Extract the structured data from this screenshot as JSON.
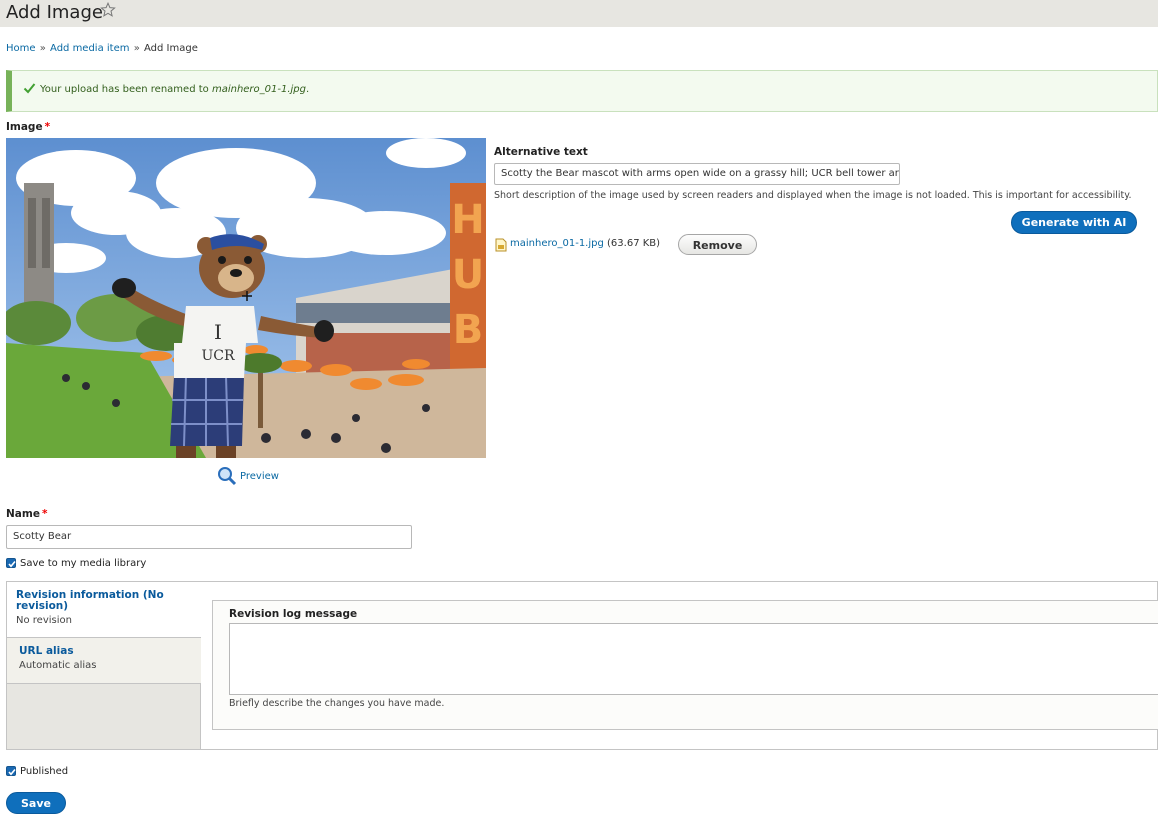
{
  "header": {
    "title": "Add Image",
    "star_icon": "star-outline-icon"
  },
  "breadcrumb": {
    "home": "Home",
    "separator": "»",
    "add_media": "Add media item",
    "current": "Add Image"
  },
  "message": {
    "icon": "check-icon",
    "prefix": "Your upload has been renamed to",
    "filename": "mainhero_01-1.jpg",
    "suffix": "."
  },
  "image_field": {
    "label": "Image",
    "required_mark": "*",
    "preview_link": "Preview",
    "preview_icon": "magnifier-icon",
    "photo_sign_text": "HUB",
    "shirt_text_1": "I",
    "shirt_text_2": "UCR",
    "alt_label": "Alternative text",
    "alt_value": "Scotty the Bear mascot with arms open wide on a grassy hill; UCR bell tower ar",
    "alt_description": "Short description of the image used by screen readers and displayed when the image is not loaded. This is important for accessibility.",
    "generate_button": "Generate with AI",
    "file_icon": "image-file-icon",
    "file_name": "mainhero_01-1.jpg",
    "file_size": "(63.67 KB)",
    "remove_button": "Remove"
  },
  "name_field": {
    "label": "Name",
    "required_mark": "*",
    "value": "Scotty Bear"
  },
  "save_to_library": {
    "label": "Save to my media library",
    "checked": true
  },
  "vertical_tabs": {
    "revision": {
      "title": "Revision information (No revision)",
      "summary": "No revision"
    },
    "url_alias": {
      "title": "URL alias",
      "summary": "Automatic alias"
    },
    "revision_log_label": "Revision log message",
    "revision_log_value": "",
    "revision_log_description": "Briefly describe the changes you have made."
  },
  "published": {
    "label": "Published",
    "checked": true
  },
  "actions": {
    "save": "Save"
  },
  "colors": {
    "primary_button": "#0f6fbc",
    "link": "#0a69a3",
    "success_border": "#77b259",
    "required": "#e00000"
  }
}
